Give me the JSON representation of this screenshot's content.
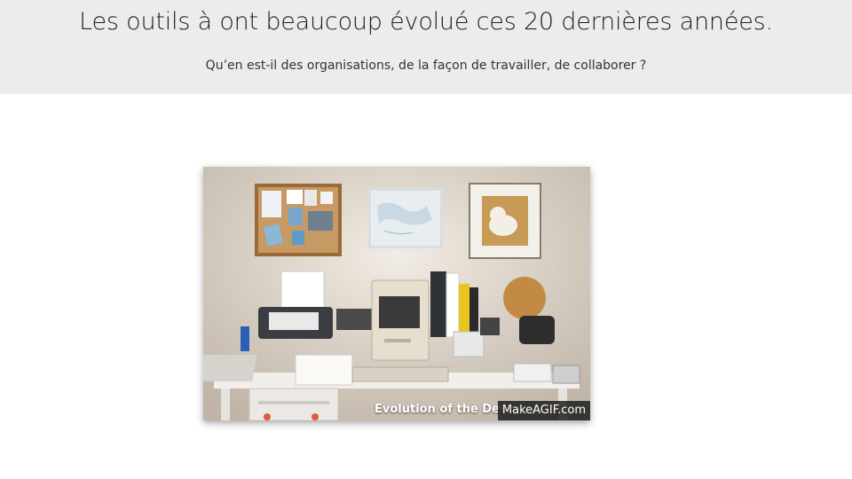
{
  "slide": {
    "title": "Les outils à ont beaucoup évolué ces 20 dernières années.",
    "subtitle": "Qu’en est-il des organisations, de la façon de travailler, de collaborer  ?"
  },
  "image": {
    "caption": "Evolution of the Desk",
    "watermark": "MakeAGIF.com"
  },
  "colors": {
    "header_bg": "#ececec",
    "page_bg": "#ffffff"
  }
}
